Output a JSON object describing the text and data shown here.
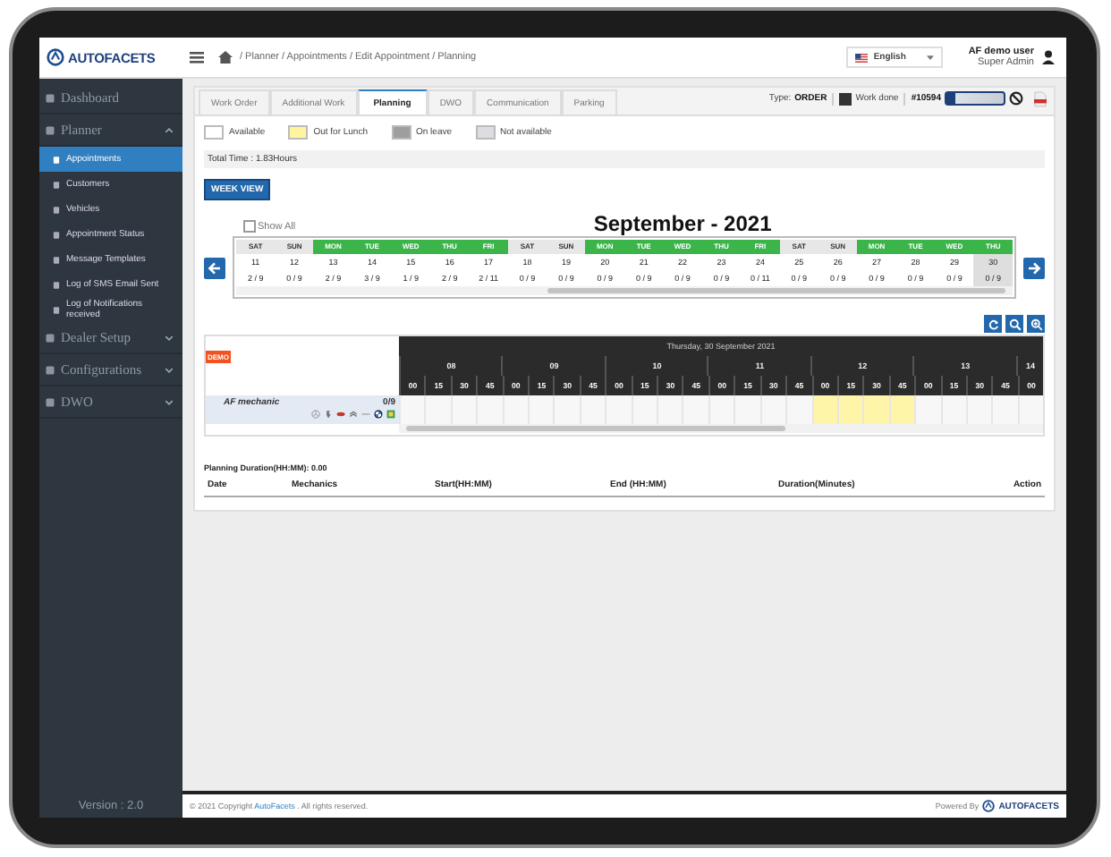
{
  "header": {
    "logo": "AUTOFACETS",
    "breadcrumb": "/ Planner / Appointments / Edit Appointment / Planning",
    "language": "English",
    "user_name": "AF demo user",
    "user_role": "Super Admin"
  },
  "sidebar": {
    "items": [
      {
        "label": "Dashboard"
      },
      {
        "label": "Planner",
        "expanded": true,
        "children": [
          {
            "label": "Appointments",
            "selected": true
          },
          {
            "label": "Customers",
            "selected": false
          },
          {
            "label": "Vehicles",
            "selected": false
          },
          {
            "label": "Appointment Status",
            "selected": false
          },
          {
            "label": "Message Templates",
            "selected": false
          },
          {
            "label": "Log of SMS Email Sent",
            "selected": false
          },
          {
            "label": "Log of Notifications received",
            "selected": false
          }
        ]
      },
      {
        "label": "Dealer Setup",
        "expanded": false
      },
      {
        "label": "Configurations",
        "expanded": false
      },
      {
        "label": "DWO",
        "expanded": false
      }
    ],
    "version": "Version : 2.0"
  },
  "tabs": [
    {
      "label": "Work Order",
      "selected": false
    },
    {
      "label": "Additional Work",
      "selected": false
    },
    {
      "label": "Planning",
      "selected": true
    },
    {
      "label": "DWO",
      "selected": false
    },
    {
      "label": "Communication",
      "selected": false
    },
    {
      "label": "Parking",
      "selected": false
    }
  ],
  "order_info": {
    "type_label": "Type:",
    "type": "ORDER",
    "work_done_label": "Work done",
    "work_done": true,
    "order_number": "#10594"
  },
  "legend": [
    {
      "label": "Available",
      "color": "#ffffff"
    },
    {
      "label": "Out for Lunch",
      "color": "#fff59d"
    },
    {
      "label": "On leave",
      "color": "#9e9e9e"
    },
    {
      "label": "Not available",
      "color": "#dcdce2"
    }
  ],
  "total_time": "Total Time : 1.83Hours",
  "week_view_button": "WEEK VIEW",
  "show_all": {
    "label": "Show All",
    "checked": false
  },
  "month_title": "September - 2021",
  "days": [
    {
      "weekday": "SAT",
      "date": "11",
      "load": "2 / 9",
      "working": false,
      "selected": false
    },
    {
      "weekday": "SUN",
      "date": "12",
      "load": "0 / 9",
      "working": false,
      "selected": false
    },
    {
      "weekday": "MON",
      "date": "13",
      "load": "2 / 9",
      "working": true,
      "selected": false
    },
    {
      "weekday": "TUE",
      "date": "14",
      "load": "3 / 9",
      "working": true,
      "selected": false
    },
    {
      "weekday": "WED",
      "date": "15",
      "load": "1 / 9",
      "working": true,
      "selected": false
    },
    {
      "weekday": "THU",
      "date": "16",
      "load": "2 / 9",
      "working": true,
      "selected": false
    },
    {
      "weekday": "FRI",
      "date": "17",
      "load": "2 / 11",
      "working": true,
      "selected": false
    },
    {
      "weekday": "SAT",
      "date": "18",
      "load": "0 / 9",
      "working": false,
      "selected": false
    },
    {
      "weekday": "SUN",
      "date": "19",
      "load": "0 / 9",
      "working": false,
      "selected": false
    },
    {
      "weekday": "MON",
      "date": "20",
      "load": "0 / 9",
      "working": true,
      "selected": false
    },
    {
      "weekday": "TUE",
      "date": "21",
      "load": "0 / 9",
      "working": true,
      "selected": false
    },
    {
      "weekday": "WED",
      "date": "22",
      "load": "0 / 9",
      "working": true,
      "selected": false
    },
    {
      "weekday": "THU",
      "date": "23",
      "load": "0 / 9",
      "working": true,
      "selected": false
    },
    {
      "weekday": "FRI",
      "date": "24",
      "load": "0 / 11",
      "working": true,
      "selected": false
    },
    {
      "weekday": "SAT",
      "date": "25",
      "load": "0 / 9",
      "working": false,
      "selected": false
    },
    {
      "weekday": "SUN",
      "date": "26",
      "load": "0 / 9",
      "working": false,
      "selected": false
    },
    {
      "weekday": "MON",
      "date": "27",
      "load": "0 / 9",
      "working": true,
      "selected": false
    },
    {
      "weekday": "TUE",
      "date": "28",
      "load": "0 / 9",
      "working": true,
      "selected": false
    },
    {
      "weekday": "WED",
      "date": "29",
      "load": "0 / 9",
      "working": true,
      "selected": false
    },
    {
      "weekday": "THU",
      "date": "30",
      "load": "0 / 9",
      "working": true,
      "selected": true
    }
  ],
  "scheduler": {
    "badge": "DEMO",
    "day_title": "Thursday, 30 September 2021",
    "hours": [
      {
        "label": "08",
        "quarters": [
          "00",
          "15",
          "30",
          "45"
        ]
      },
      {
        "label": "09",
        "quarters": [
          "00",
          "15",
          "30",
          "45"
        ]
      },
      {
        "label": "10",
        "quarters": [
          "00",
          "15",
          "30",
          "45"
        ]
      },
      {
        "label": "11",
        "quarters": [
          "00",
          "15",
          "30",
          "45"
        ]
      },
      {
        "label": "12",
        "quarters": [
          "00",
          "15",
          "30",
          "45"
        ]
      },
      {
        "label": "13",
        "quarters": [
          "00",
          "15",
          "30",
          "45"
        ]
      },
      {
        "label": "14",
        "quarters": [
          "00"
        ]
      }
    ],
    "mechanics": [
      {
        "name": "AF mechanic",
        "load": "0/9",
        "slots": [
          {
            "lunch": false
          },
          {
            "lunch": false
          },
          {
            "lunch": false
          },
          {
            "lunch": false
          },
          {
            "lunch": false
          },
          {
            "lunch": false
          },
          {
            "lunch": false
          },
          {
            "lunch": false
          },
          {
            "lunch": false
          },
          {
            "lunch": false
          },
          {
            "lunch": false
          },
          {
            "lunch": false
          },
          {
            "lunch": false
          },
          {
            "lunch": false
          },
          {
            "lunch": false
          },
          {
            "lunch": false
          },
          {
            "lunch": true
          },
          {
            "lunch": true
          },
          {
            "lunch": true
          },
          {
            "lunch": true
          },
          {
            "lunch": false
          },
          {
            "lunch": false
          },
          {
            "lunch": false
          },
          {
            "lunch": false
          },
          {
            "lunch": false
          }
        ]
      }
    ]
  },
  "planning_duration": "Planning Duration(HH:MM): 0.00",
  "table": {
    "columns": [
      "Date",
      "Mechanics",
      "Start(HH:MM)",
      "End (HH:MM)",
      "Duration(Minutes)",
      "Action"
    ]
  },
  "footer": {
    "copyright_before": "© 2021 Copyright ",
    "link": "AutoFacets",
    "copyright_after": " . All rights reserved.",
    "powered_by": "Powered By",
    "powered_logo": "AUTOFACETS"
  }
}
